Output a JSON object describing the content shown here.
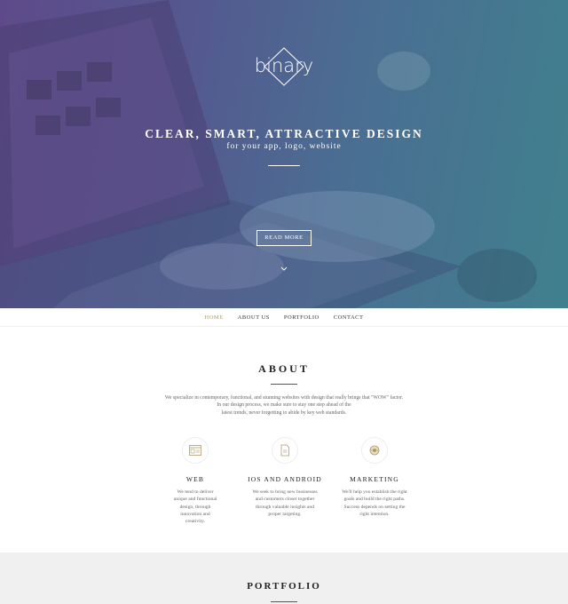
{
  "brand": {
    "logo_text": "binary"
  },
  "hero": {
    "headline": "CLEAR, SMART, ATTRACTIVE DESIGN",
    "subline": "for your app, logo, website",
    "cta_label": "READ MORE"
  },
  "nav": {
    "items": [
      {
        "label": "HOME",
        "active": true
      },
      {
        "label": "ABOUT US",
        "active": false
      },
      {
        "label": "PORTFOLIO",
        "active": false
      },
      {
        "label": "CONTACT",
        "active": false
      }
    ]
  },
  "about": {
    "title": "ABOUT",
    "intro_lines": [
      "We specialize in contemporary, functional, and stunning websites with design that really brings that \"WOW\" factor.",
      "In our design process, we make sure to stay one step ahead of the",
      "latest trends, never forgetting to abide by key web standards."
    ],
    "features": [
      {
        "icon": "browser-window-icon",
        "title": "WEB",
        "lines": [
          "We tend to deliver",
          "unique and functional",
          "design, through",
          "innovation and",
          "creativity."
        ]
      },
      {
        "icon": "mobile-page-icon",
        "title": "IOS AND ANDROID",
        "lines": [
          "We seek to bring new businesses",
          "and customers closer together",
          "through valuable insights and",
          "proper targeting."
        ]
      },
      {
        "icon": "target-icon",
        "title": "MARKETING",
        "lines": [
          "We'll help you establish the right",
          "goals and build the right paths.",
          "Success depends on setting the",
          "right intention."
        ]
      }
    ]
  },
  "portfolio": {
    "title": "PORTFOLIO"
  },
  "colors": {
    "accent": "#b09a6c",
    "hero_start": "#5e4a8a",
    "hero_end": "#40808e"
  }
}
